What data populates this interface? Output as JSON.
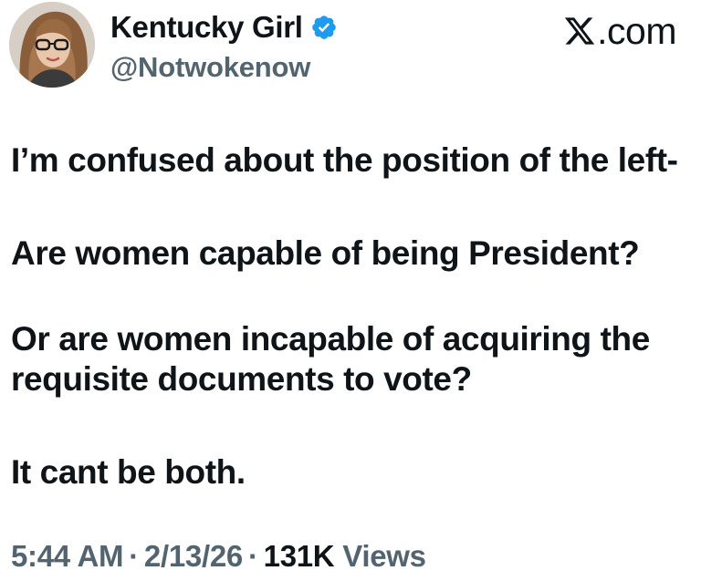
{
  "author": {
    "display_name": "Kentucky Girl",
    "handle": "@Notwokenow",
    "verified": true,
    "verified_color": "#1d9bf0"
  },
  "header": {
    "site_text": ".com",
    "site_logo": "x-logo"
  },
  "tweet": {
    "line1": "I’m confused about the position of the left-",
    "line2": "Are women capable of being President?",
    "line3": "Or are women incapable of acquiring the",
    "line4": "requisite documents to vote?",
    "line5": "It cant be both."
  },
  "meta": {
    "time": "5:44 AM",
    "separator": "·",
    "date": "2/13/26",
    "views_count": "131K",
    "views_label": "Views"
  },
  "colors": {
    "text_primary": "#0f1419",
    "text_secondary": "#536471",
    "background": "#ffffff"
  }
}
